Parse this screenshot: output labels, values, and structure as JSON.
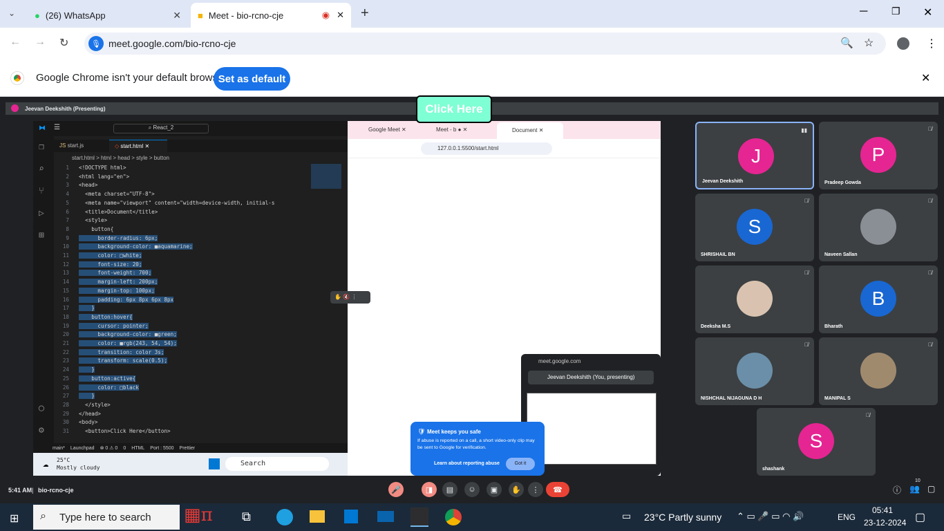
{
  "browser": {
    "tabs": [
      {
        "label": "(26) WhatsApp"
      },
      {
        "label": "Meet - bio-rcno-cje"
      }
    ],
    "url": "meet.google.com/bio-rcno-cje",
    "infobar_text": "Google Chrome isn't your default browser",
    "set_default": "Set as default"
  },
  "meet": {
    "presenting": "Jeevan Deekshith (Presenting)",
    "meeting_code": "bio-rcno-cje",
    "time": "5:41 AM",
    "participants_count": "10",
    "participants": [
      {
        "name": "Jeevan Deekshith",
        "initial": "J",
        "color": "#e52592"
      },
      {
        "name": "Pradeep Gowda",
        "initial": "P",
        "color": "#e52592"
      },
      {
        "name": "SHRISHAIL BN",
        "initial": "S",
        "color": "#1967d2"
      },
      {
        "name": "Naveen Sallan",
        "initial": "",
        "color": "#8a8f95"
      },
      {
        "name": "Deeksha M.S",
        "initial": "",
        "color": "#d9c3b0"
      },
      {
        "name": "Bharath",
        "initial": "B",
        "color": "#1967d2"
      },
      {
        "name": "NISHCHAL NIJAGUNA D H",
        "initial": "",
        "color": "#6b8fa8"
      },
      {
        "name": "MANIPAL S",
        "initial": "",
        "color": "#a08a6e"
      },
      {
        "name": "shashank",
        "initial": "S",
        "color": "#e52592"
      }
    ],
    "pip": {
      "host": "meet.google.com",
      "label": "Jeevan Deekshith (You, presenting)"
    },
    "safe_popup": {
      "title": "Meet keeps you safe",
      "body": "If abuse is reported on a call, a short video-only clip may be sent to Google for verification.",
      "learn": "Learn about reporting abuse",
      "ok": "Got it"
    }
  },
  "vscode": {
    "search": "React_2",
    "tabs": [
      "start.js",
      "start.html"
    ],
    "breadcrumb": "start.html > html > head > style > button",
    "lines": [
      "<!DOCTYPE html>",
      "<html lang=\"en\">",
      "<head>",
      "  <meta charset=\"UTF-8\">",
      "  <meta name=\"viewport\" content=\"width=device-width, initial-s",
      "  <title>Document</title>",
      "  <style>",
      "    button{",
      "      border-radius: 6px;",
      "      background-color: ■aquamarine;",
      "      color: □white;",
      "      font-size: 20;",
      "      font-weight: 700;",
      "      margin-left: 200px;",
      "      margin-top: 100px;",
      "      padding: 6px 8px 6px 8px",
      "    }",
      "    button:hover{",
      "      cursor: pointer;",
      "      background-color: ■green;",
      "      color: ■rgb(243, 54, 54);",
      "      transition: color 3s;",
      "      transform: scale(0.5);",
      "    }",
      "    button:active{",
      "      color: □black",
      "    }",
      "  </style>",
      "</head>",
      "<body>",
      "  <button>Click Here</button>"
    ],
    "status": [
      "main*",
      "Launchpad",
      "⊗ 0 ⚠ 0",
      "0",
      "HTML",
      "Port : 5500",
      "Prettier"
    ],
    "weather": "25°C",
    "weather_desc": "Mostly cloudy",
    "win_search": "Search"
  },
  "inner_browser": {
    "tabs": [
      "Google Meet",
      "Meet - b",
      "Document"
    ],
    "url": "127.0.0.1:5500/start.html",
    "button": "Click Here"
  },
  "taskbar": {
    "search": "Type here to search",
    "weather": "23°C  Partly sunny",
    "lang": "ENG",
    "time": "05:41",
    "date": "23-12-2024"
  }
}
